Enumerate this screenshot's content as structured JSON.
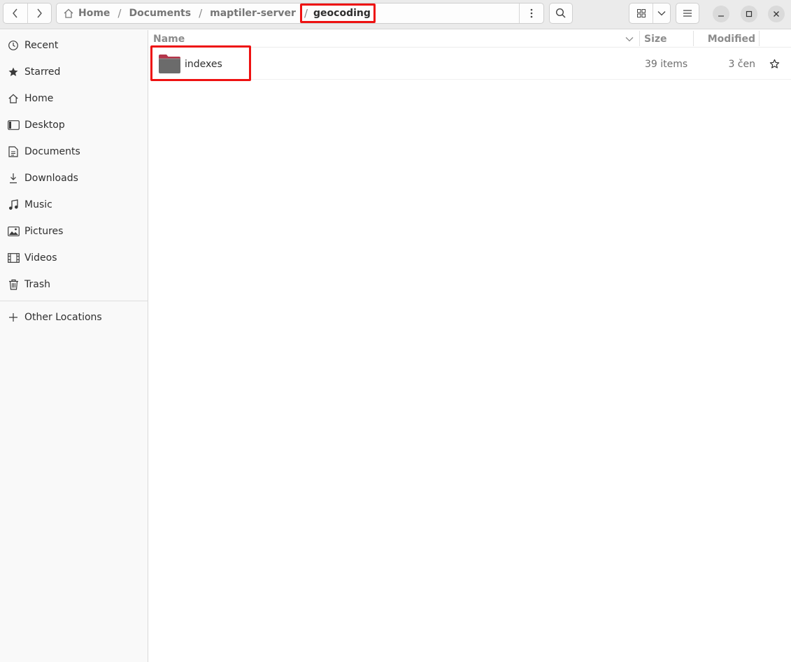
{
  "breadcrumbs": [
    {
      "label": "Home"
    },
    {
      "label": "Documents"
    },
    {
      "label": "maptiler-server"
    },
    {
      "label": "geocoding"
    }
  ],
  "separator": "/",
  "sidebar": {
    "items": [
      {
        "label": "Recent",
        "icon": "clock-icon"
      },
      {
        "label": "Starred",
        "icon": "star-icon"
      },
      {
        "label": "Home",
        "icon": "home-icon"
      },
      {
        "label": "Desktop",
        "icon": "desktop-icon"
      },
      {
        "label": "Documents",
        "icon": "document-icon"
      },
      {
        "label": "Downloads",
        "icon": "download-icon"
      },
      {
        "label": "Music",
        "icon": "music-icon"
      },
      {
        "label": "Pictures",
        "icon": "picture-icon"
      },
      {
        "label": "Videos",
        "icon": "film-icon"
      },
      {
        "label": "Trash",
        "icon": "trash-icon"
      }
    ],
    "other_locations": {
      "label": "Other Locations",
      "icon": "plus-icon"
    }
  },
  "columns": {
    "name": "Name",
    "size": "Size",
    "modified": "Modified"
  },
  "files": [
    {
      "name": "indexes",
      "size": "39 items",
      "modified": "3 čen",
      "icon": "folder-icon",
      "starred": false
    }
  ],
  "colors": {
    "highlight": "#ee1111",
    "folder_tab": "#b4354a",
    "folder_body": "#6b6b6b"
  }
}
